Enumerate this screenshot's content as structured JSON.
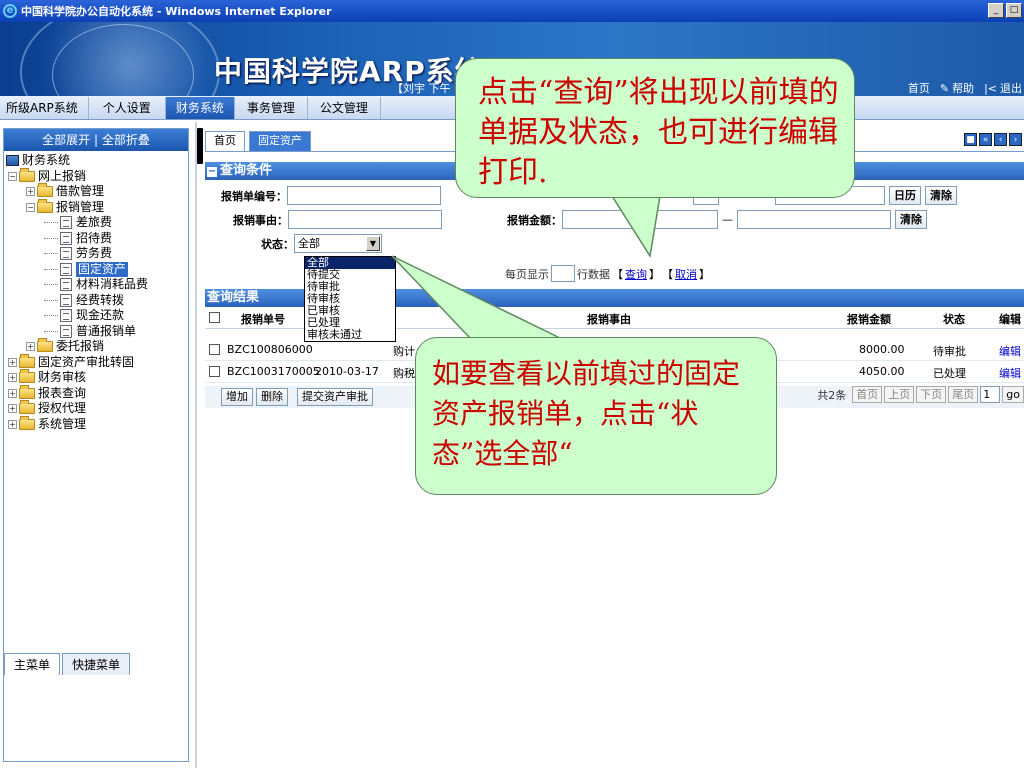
{
  "window": {
    "title": "中国科学院办公自动化系统",
    "title_suffix": " - Windows Internet Explorer",
    "buttons": [
      "_",
      "□"
    ]
  },
  "banner": {
    "app_title": "中国科学院ARP系统",
    "user_info": "【刘宇 下午"
  },
  "top_links": {
    "home": "首页",
    "help": "帮助",
    "logout": "退出"
  },
  "menubar": {
    "items": [
      "所级ARP系统",
      "个人设置",
      "财务系统",
      "事务管理",
      "公文管理"
    ],
    "active_index": 2
  },
  "sidebar": {
    "expand_all": "全部展开",
    "collapse_all": "全部折叠",
    "tree": [
      {
        "label": "财务系统",
        "level": 0,
        "icon": "computer"
      },
      {
        "label": "网上报销",
        "level": 1,
        "icon": "folder",
        "expander": "-"
      },
      {
        "label": "借款管理",
        "level": 2,
        "icon": "folder",
        "expander": "+"
      },
      {
        "label": "报销管理",
        "level": 2,
        "icon": "folder",
        "expander": "-"
      },
      {
        "label": "差旅费",
        "level": 3,
        "icon": "page"
      },
      {
        "label": "招待费",
        "level": 3,
        "icon": "page"
      },
      {
        "label": "劳务费",
        "level": 3,
        "icon": "page"
      },
      {
        "label": "固定资产",
        "level": 3,
        "icon": "page",
        "selected": true
      },
      {
        "label": "材料消耗品费",
        "level": 3,
        "icon": "page"
      },
      {
        "label": "经费转拨",
        "level": 3,
        "icon": "page"
      },
      {
        "label": "现金还款",
        "level": 3,
        "icon": "page"
      },
      {
        "label": "普通报销单",
        "level": 3,
        "icon": "page"
      },
      {
        "label": "委托报销",
        "level": 2,
        "icon": "folder",
        "expander": "+"
      },
      {
        "label": "固定资产审批转固",
        "level": 1,
        "icon": "folder",
        "expander": "+"
      },
      {
        "label": "财务审核",
        "level": 1,
        "icon": "folder",
        "expander": "+"
      },
      {
        "label": "报表查询",
        "level": 1,
        "icon": "folder",
        "expander": "+"
      },
      {
        "label": "授权代理",
        "level": 1,
        "icon": "folder",
        "expander": "+"
      },
      {
        "label": "系统管理",
        "level": 1,
        "icon": "folder",
        "expander": "+"
      }
    ],
    "bottom_tabs": [
      "主菜单",
      "快捷菜单"
    ]
  },
  "content_tabs": [
    "首页",
    "固定资产"
  ],
  "query": {
    "section_title": "查询条件",
    "doc_no_label": "报销单编号：",
    "reason_label": "报销事由：",
    "amount_label": "报销金额：",
    "status_label": "状态：",
    "status_value": "全部",
    "status_options": [
      "全部",
      "待提交",
      "待审批",
      "待审核",
      "已审核",
      "已处理",
      "审核未通过"
    ],
    "calendar_btn": "日历",
    "clear_btn": "清除",
    "range_sep": "—",
    "pager_prefix": "每页显示",
    "pager_suffix": "行数据",
    "query_link": "查询",
    "cancel_link": "取消",
    "bracket_open": "【",
    "bracket_close": "】"
  },
  "results": {
    "section_title": "查询结果",
    "columns": {
      "doc_no": "报销单号",
      "reason": "报销事由",
      "amount": "报销金额",
      "status": "状态",
      "edit": "编辑"
    },
    "rows": [
      {
        "doc_no": "BZC100806000",
        "date": "",
        "reason": "购计",
        "amount": "8000.00",
        "status": "待审批",
        "edit": "编辑"
      },
      {
        "doc_no": "BZC1003170005",
        "date": "2010-03-17",
        "reason": "购税",
        "amount": "4050.00",
        "status": "已处理",
        "edit": "编辑"
      }
    ],
    "actions": [
      "增加",
      "删除",
      "提交资产审批"
    ],
    "total": "共2条",
    "pager_buttons": [
      "首页",
      "上页",
      "下页",
      "尾页"
    ],
    "page_value": "1",
    "go": "go"
  },
  "callouts": {
    "top": "点击“查询”将出现以前填的单据及状态，也可进行编辑打印.",
    "bottom": "如要查看以前填过的固定资产报销单，点击“状态”选全部“"
  },
  "colors": {
    "callout_bg": "#ccffcc",
    "callout_text": "#cc0000",
    "menu_active": "#2e6bc8",
    "section_head": "#2b62bc"
  }
}
